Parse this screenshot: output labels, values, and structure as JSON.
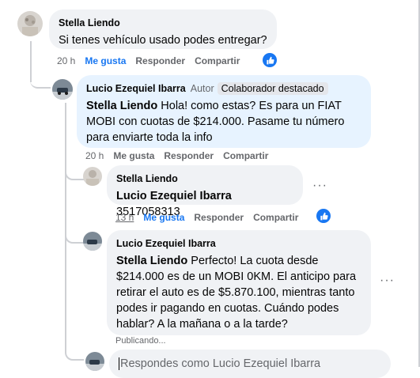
{
  "comments": [
    {
      "author": "Stella Liendo",
      "text": "Si tenes vehículo usado podes entregar?",
      "time": "20 h",
      "like": "Me gusta",
      "reply": "Responder",
      "share": "Compartir"
    },
    {
      "author": "Lucio Ezequiel Ibarra",
      "role": "Autor",
      "badge": "Colaborador destacado",
      "mention": "Stella Liendo",
      "text": " Hola! como estas? Es para un FIAT MOBI con cuotas de $214.000. Pasame tu número para enviarte toda la info",
      "time": "20 h",
      "like": "Me gusta",
      "reply": "Responder",
      "share": "Compartir"
    },
    {
      "author": "Stella Liendo",
      "mention": "Lucio Ezequiel Ibarra",
      "text": " 3517058313",
      "time": "13 h",
      "like": "Me gusta",
      "reply": "Responder",
      "share": "Compartir"
    },
    {
      "author": "Lucio Ezequiel Ibarra",
      "mention": "Stella Liendo",
      "text": " Perfecto! La cuota desde $214.000 es de un MOBI 0KM. El anticipo para retirar el auto es de $5.870.100, mientras tanto podes ir pagando en cuotas. Cuándo podes hablar? A la mañana o a la tarde?",
      "status": "Publicando..."
    }
  ],
  "reply_box": {
    "placeholder": "Respondes como Lucio Ezequiel Ibarra"
  },
  "more_label": "···",
  "colors": {
    "accent": "#1877f2",
    "bubble_grey": "#f0f2f5",
    "bubble_highlight": "#e7f3ff"
  },
  "icons": [
    "like-reaction-icon",
    "more-options-icon"
  ]
}
